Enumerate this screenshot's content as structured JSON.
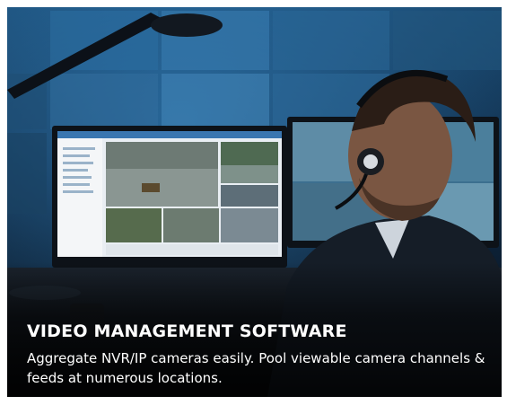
{
  "card": {
    "title": "VIDEO MANAGEMENT SOFTWARE",
    "description": "Aggregate NVR/IP cameras easily. Pool viewable camera channels & feeds at numerous locations."
  },
  "colors": {
    "background": "#0b1420",
    "text": "#ffffff",
    "screen_glow": "#2f86c9"
  }
}
